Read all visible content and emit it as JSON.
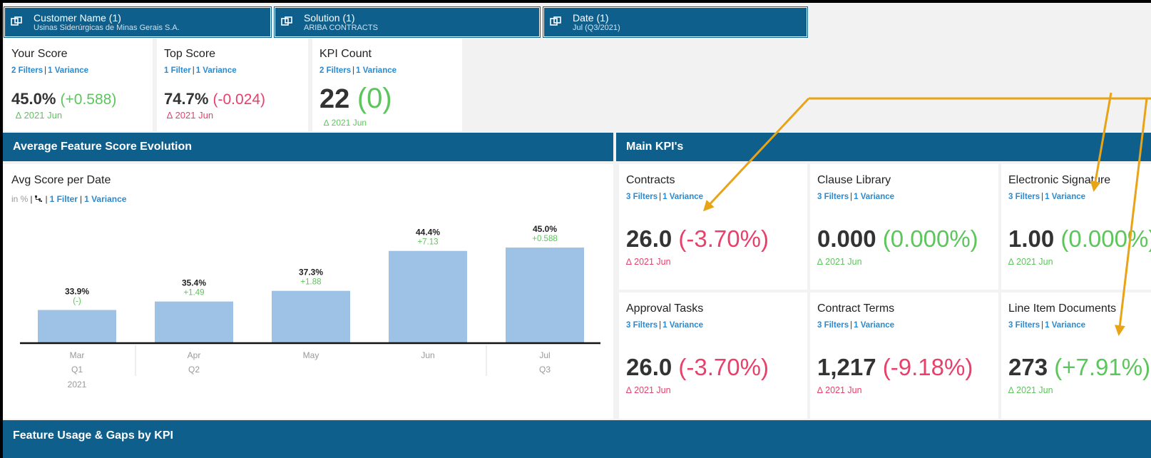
{
  "filters": [
    {
      "title": "Customer Name (1)",
      "value": "Usinas Siderúrgicas de Minas Gerais S.A."
    },
    {
      "title": "Solution (1)",
      "value": "ARIBA CONTRACTS"
    },
    {
      "title": "Date (1)",
      "value": "Jul (Q3/2021)"
    }
  ],
  "score_tiles": [
    {
      "title": "Your Score",
      "filters": "2 Filters",
      "variance": "1 Variance",
      "value": "45.0%",
      "change": "(+0.588)",
      "change_color": "green",
      "delta": "∆ 2021 Jun"
    },
    {
      "title": "Top Score",
      "filters": "1 Filter",
      "variance": "1 Variance",
      "value": "74.7%",
      "change": "(-0.024)",
      "change_color": "red",
      "delta": "∆ 2021 Jun"
    },
    {
      "title": "KPI Count",
      "filters": "2 Filters",
      "variance": "1 Variance",
      "value": "22",
      "change": "(0)",
      "change_color": "green",
      "delta": "∆ 2021 Jun"
    }
  ],
  "sections": {
    "evolution": "Average Feature Score Evolution",
    "main_kpis": "Main KPI's",
    "usage": "Feature Usage & Gaps by KPI"
  },
  "chart_panel": {
    "title": "Avg Score per Date",
    "unit": "in %",
    "filter_link": "1 Filter",
    "variance_link": "1 Variance"
  },
  "chart_data": {
    "type": "bar",
    "categories": [
      "Mar",
      "Apr",
      "May",
      "Jun",
      "Jul"
    ],
    "quarters": [
      "Q1",
      "Q2",
      "",
      "",
      "Q3"
    ],
    "year": "2021",
    "values": [
      33.9,
      35.4,
      37.3,
      44.4,
      45.0
    ],
    "value_labels": [
      "33.9%",
      "35.4%",
      "37.3%",
      "44.4%",
      "45.0%"
    ],
    "variance_labels": [
      "(-)",
      "+1.49",
      "+1.88",
      "+7.13",
      "+0.588"
    ],
    "bar_color": "#9dc2e6",
    "variance_color": "#5cc55c"
  },
  "kpis": [
    {
      "title": "Contracts",
      "filters": "3 Filters",
      "variance": "1 Variance",
      "value": "26.0",
      "change": "(-3.70%)",
      "change_color": "red",
      "delta": "∆ 2021 Jun"
    },
    {
      "title": "Clause Library",
      "filters": "3 Filters",
      "variance": "1 Variance",
      "value": "0.000",
      "change": "(0.000%)",
      "change_color": "green",
      "delta": "∆ 2021 Jun"
    },
    {
      "title": "Electronic Signature",
      "filters": "3 Filters",
      "variance": "1 Variance",
      "value": "1.00",
      "change": "(0.000%)",
      "change_color": "green",
      "delta": "∆ 2021 Jun"
    },
    {
      "title": "Approval Tasks",
      "filters": "3 Filters",
      "variance": "1 Variance",
      "value": "26.0",
      "change": "(-3.70%)",
      "change_color": "red",
      "delta": "∆ 2021 Jun"
    },
    {
      "title": "Contract Terms",
      "filters": "3 Filters",
      "variance": "1 Variance",
      "value": "1,217",
      "change": "(-9.18%)",
      "change_color": "red",
      "delta": "∆ 2021 Jun"
    },
    {
      "title": "Line Item Documents",
      "filters": "3 Filters",
      "variance": "1 Variance",
      "value": "273",
      "change": "(+7.91%)",
      "change_color": "green",
      "delta": "∆ 2021 Jun"
    }
  ],
  "colors": {
    "header": "#0f5f8c",
    "red": "#e8406a",
    "green": "#5cc55c",
    "link": "#2a8ad0",
    "annotation_arrow": "#e8a317"
  }
}
